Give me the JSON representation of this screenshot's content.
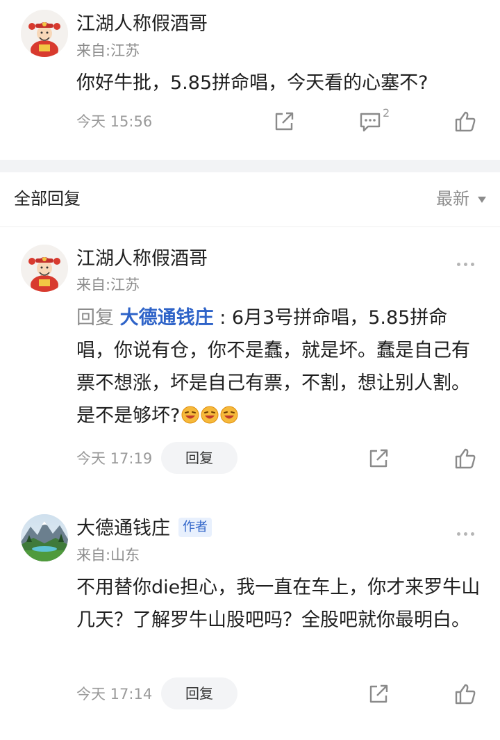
{
  "post": {
    "user_name": "江湖人称假酒哥",
    "region": "来自:江苏",
    "content": "你好牛批，5.85拼命唱，今天看的心塞不?",
    "time": "今天 15:56",
    "comment_count": "2",
    "icons": {
      "share": "share-icon",
      "comment": "comment-icon",
      "like": "thumbs-up-icon"
    }
  },
  "replies_header": {
    "title": "全部回复",
    "sort_label": "最新"
  },
  "replies": [
    {
      "user_name": "江湖人称假酒哥",
      "region": "来自:江苏",
      "reply_prefix": "回复",
      "reply_target": "大德通钱庄",
      "content": ": 6月3号拼命唱，5.85拼命唱，你说有仓，你不是蠢，就是坏。蠢是自己有票不想涨，坏是自己有票，不割，想让别人割。是不是够坏?",
      "emoji_count": 3,
      "time": "今天 17:19",
      "reply_button": "回复"
    },
    {
      "user_name": "大德通钱庄",
      "author_badge": "作者",
      "region": "来自:山东",
      "content": "不用替你die担心，我一直在车上，你才来罗牛山几天？了解罗牛山股吧吗？全股吧就你最明白。",
      "time": "今天 17:14",
      "reply_button": "回复"
    }
  ],
  "colors": {
    "link_blue": "#2e63c8",
    "secondary_text": "#8c8c8c",
    "divider": "#f2f3f5"
  }
}
